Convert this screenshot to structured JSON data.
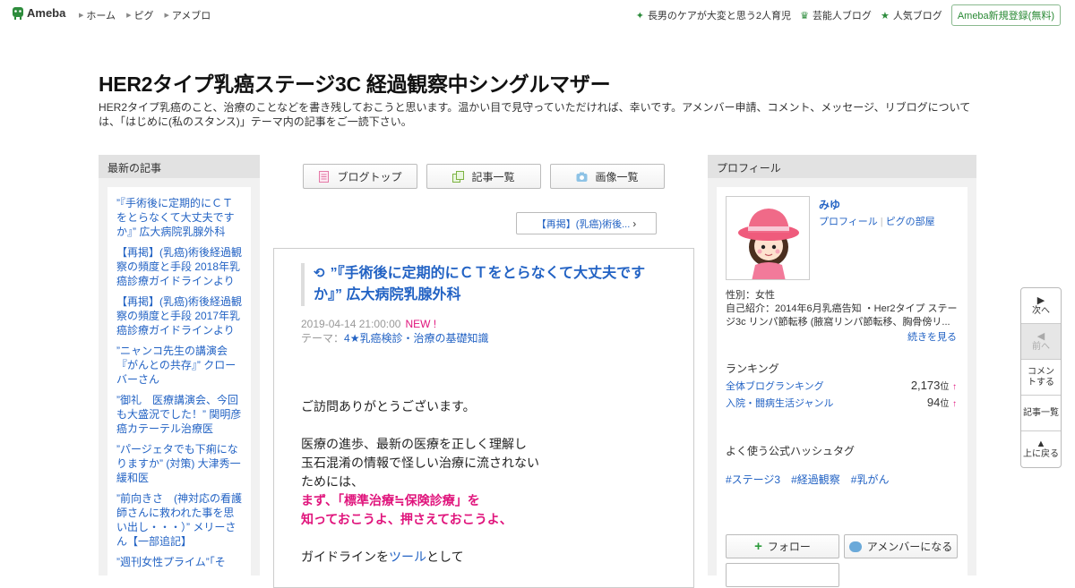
{
  "topbar": {
    "logo_text": "Ameba",
    "nav": [
      "ホーム",
      "ピグ",
      "アメブロ"
    ],
    "right_links": [
      {
        "label": "長男のケアが大変と思う2人育児",
        "icon": "sparkle-icon"
      },
      {
        "label": "芸能人ブログ",
        "icon": "crown-icon"
      },
      {
        "label": "人気ブログ",
        "icon": "star-icon"
      }
    ],
    "register_label": "Ameba新規登録(無料)",
    "accent": "#2d8c3c"
  },
  "header": {
    "title": "HER2タイプ乳癌ステージ3C 経過観察中シングルマザー",
    "description": "HER2タイプ乳癌のこと、治療のことなどを書き残しておこうと思います。温かい目で見守っていただければ、幸いです。アメンバー申請、コメント、メッセージ、リブログについては、「はじめに(私のスタンス)」テーマ内の記事をご一読下さい。"
  },
  "recent": {
    "heading": "最新の記事",
    "entries": [
      "”『手術後に定期的にＣＴをとらなくて大丈夫ですか』” 広大病院乳腺外科",
      "【再掲】(乳癌)術後経過観察の頻度と手段 2018年乳癌診療ガイドラインより",
      "【再掲】(乳癌)術後経過観察の頻度と手段 2017年乳癌診療ガイドラインより",
      "”ニャンコ先生の講演会『がんとの共存』” クローバーさん",
      "”御礼　医療講演会、今回も大盛況でした！” 関明彦癌カテーテル治療医",
      "”パージェタでも下痢になりますか” (対策) 大津秀一緩和医",
      "”前向きさ　(神対応の看護師さんに救われた事を思い出し・・・）” メリーさん【一部追記】",
      "”週刊女性プライム”「そ"
    ]
  },
  "buttons": {
    "blog_top": "ブログトップ",
    "entry_list": "記事一覧",
    "image_list": "画像一覧",
    "prev_entry": "【再掲】(乳癌)術後..."
  },
  "article": {
    "title": "”『手術後に定期的にＣＴをとらなくて大丈夫ですか』” 広大病院乳腺外科",
    "date": "2019-04-14 21:00:00",
    "new_label": "NEW !",
    "theme_label": "テーマ：",
    "theme": "4★乳癌検診・治療の基礎知識",
    "body": {
      "l1": "ご訪問ありがとうございます。",
      "l2": "医療の進歩、最新の医療を正しく理解し",
      "l3": "玉石混淆の情報で怪しい治療に流されない",
      "l4": "ためには、",
      "l5": "まず、「標準治療≒保険診療」を",
      "l6": "知っておこうよ、押さえておこうよ、",
      "l7a": "ガイドラインを",
      "l7b": "ツール",
      "l7c": "として"
    }
  },
  "profile": {
    "heading": "プロフィール",
    "name": "みゆ",
    "link_profile": "プロフィール",
    "link_room": "ピグの部屋",
    "gender": "性別：女性",
    "intro": "自己紹介：2014年6月乳癌告知 ・Her2タイプ ステージ3c リンパ節転移 (腋窩リンパ節転移、胸骨傍リ...",
    "more": "続きを見る",
    "ranking_heading": "ランキング",
    "rankings": [
      {
        "label": "全体ブログランキング",
        "value": "2,173",
        "unit": "位",
        "arrow": "↑"
      },
      {
        "label": "入院・闘病生活ジャンル",
        "value": "94",
        "unit": "位",
        "arrow": "↑"
      }
    ],
    "hashtag_heading": "よく使う公式ハッシュタグ",
    "hashtags": [
      "#ステージ3",
      "#経過観察",
      "#乳がん"
    ],
    "follow": "フォロー",
    "amember": "アメンバーになる"
  },
  "sidenav": {
    "next": "次へ",
    "prev": "前へ",
    "comment": "コメントする",
    "list": "記事一覧",
    "top": "上に戻る"
  }
}
